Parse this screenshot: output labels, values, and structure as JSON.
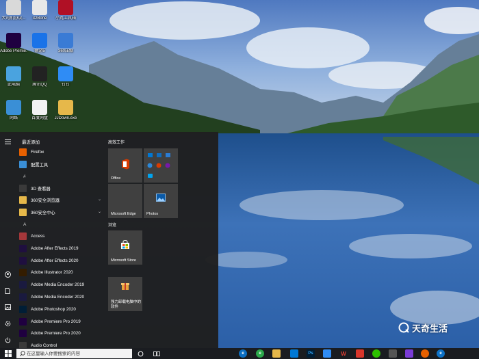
{
  "desktop_icons": [
    {
      "label": "大司机协议...",
      "icon": "user-file-icon",
      "color": "#d9d9d9"
    },
    {
      "label": "32Bone",
      "icon": "document-icon",
      "color": "#e8e8e8"
    },
    {
      "label": "小丸工具箱",
      "icon": "wan-icon",
      "color": "#b01025"
    },
    {
      "label": "Adobe Premie...",
      "icon": "premiere-icon",
      "color": "#1f0040"
    },
    {
      "label": "傲游5",
      "icon": "maxthon-icon",
      "color": "#1a73e8"
    },
    {
      "label": "360压缩",
      "icon": "archive-icon",
      "color": "#3a7bd5"
    },
    {
      "label": "此电脑",
      "icon": "computer-icon",
      "color": "#4aa3df"
    },
    {
      "label": "腾讯QQ",
      "icon": "qq-icon",
      "color": "#222"
    },
    {
      "label": "钉钉",
      "icon": "dingtalk-icon",
      "color": "#2f8cf5"
    },
    {
      "label": "网络",
      "icon": "network-icon",
      "color": "#3a8fd6"
    },
    {
      "label": "百度网盘",
      "icon": "baidu-netdisk-icon",
      "color": "#f2f2f2"
    },
    {
      "label": "JJDown.exe",
      "icon": "folder-icon",
      "color": "#e6b84a"
    }
  ],
  "start_menu": {
    "recent_header": "最近添加",
    "recent_apps": [
      {
        "label": "Firefox",
        "icon": "firefox-icon",
        "color": "#e66000"
      },
      {
        "label": "配置工具",
        "icon": "tools-icon",
        "color": "#3a8fd6"
      }
    ],
    "sections": [
      {
        "letter": "#",
        "apps": [
          {
            "label": "3D 查看器",
            "icon": "cube-3d-icon",
            "color": "#3a3a3a",
            "chevron": ""
          },
          {
            "label": "360安全浏览器",
            "icon": "folder-icon",
            "color": "#e6b84a",
            "chevron": "⌄"
          },
          {
            "label": "360安全中心",
            "icon": "folder-icon",
            "color": "#e6b84a",
            "chevron": "⌄"
          }
        ]
      },
      {
        "letter": "A",
        "apps": [
          {
            "label": "Access",
            "icon": "access-icon",
            "color": "#a4373a",
            "chevron": ""
          },
          {
            "label": "Adobe After Effects 2019",
            "icon": "after-effects-icon",
            "color": "#1f0f3f",
            "chevron": ""
          },
          {
            "label": "Adobe After Effects 2020",
            "icon": "after-effects-icon",
            "color": "#1f0f3f",
            "chevron": ""
          },
          {
            "label": "Adobe Illustrator 2020",
            "icon": "illustrator-icon",
            "color": "#331c00",
            "chevron": ""
          },
          {
            "label": "Adobe Media Encoder 2019",
            "icon": "media-encoder-icon",
            "color": "#1a1a3f",
            "chevron": ""
          },
          {
            "label": "Adobe Media Encoder 2020",
            "icon": "media-encoder-icon",
            "color": "#1a1a3f",
            "chevron": ""
          },
          {
            "label": "Adobe Photoshop 2020",
            "icon": "photoshop-icon",
            "color": "#001e36",
            "chevron": ""
          },
          {
            "label": "Adobe Premiere Pro 2019",
            "icon": "premiere-icon",
            "color": "#1f0040",
            "chevron": ""
          },
          {
            "label": "Adobe Premiere Pro 2020",
            "icon": "premiere-icon",
            "color": "#1f0040",
            "chevron": ""
          },
          {
            "label": "Audio Control",
            "icon": "audio-icon",
            "color": "#3a3a3a",
            "chevron": ""
          }
        ]
      }
    ],
    "tile_groups": [
      {
        "title": "高效工作"
      },
      {
        "title": "浏览"
      }
    ],
    "tiles": [
      {
        "label": "Office",
        "icon": "office-icon"
      },
      {
        "label": "",
        "icon": "mail-apps-icon"
      },
      {
        "label": "Microsoft Edge",
        "icon": "edge-icon"
      },
      {
        "label": "Photos",
        "icon": "photos-icon"
      },
      {
        "label": "Microsoft Store",
        "icon": "store-icon"
      },
      {
        "label": "强力卸载电脑中的软件",
        "icon": "uninstall-icon"
      }
    ]
  },
  "taskbar": {
    "search_placeholder": "在这里输入你要搜索的内容"
  },
  "watermark": {
    "text": "天奇生活"
  }
}
